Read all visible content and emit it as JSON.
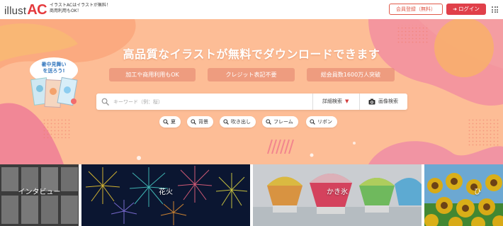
{
  "header": {
    "logo_text_a": "illust",
    "logo_text_b": "AC",
    "tagline_line1": "イラストACはイラストが無料！",
    "tagline_line2": "商用利用もOK！",
    "register_label": "会員登録（無料）",
    "login_label": "ログイン"
  },
  "hero": {
    "title": "高品質なイラストが無料でダウンロードできます",
    "pills": [
      "加工や商用利用もOK",
      "クレジット表記不要",
      "総会員数1600万人突破"
    ],
    "campaign": {
      "line1": "暑中見舞い",
      "line2": "を送ろう!"
    }
  },
  "search": {
    "placeholder": "キーワード（例：桜）",
    "advanced_label": "詳細検索",
    "image_search_label": "画像検索"
  },
  "tags": [
    "夏",
    "背景",
    "吹き出し",
    "フレーム",
    "リボン"
  ],
  "categories": [
    {
      "label": "インタビュー"
    },
    {
      "label": "花火"
    },
    {
      "label": "かき氷"
    },
    {
      "label": "ひ"
    }
  ],
  "colors": {
    "brand_red": "#e4393c",
    "hero_bg": "#fdbd96",
    "login_bg": "#e0404a"
  }
}
